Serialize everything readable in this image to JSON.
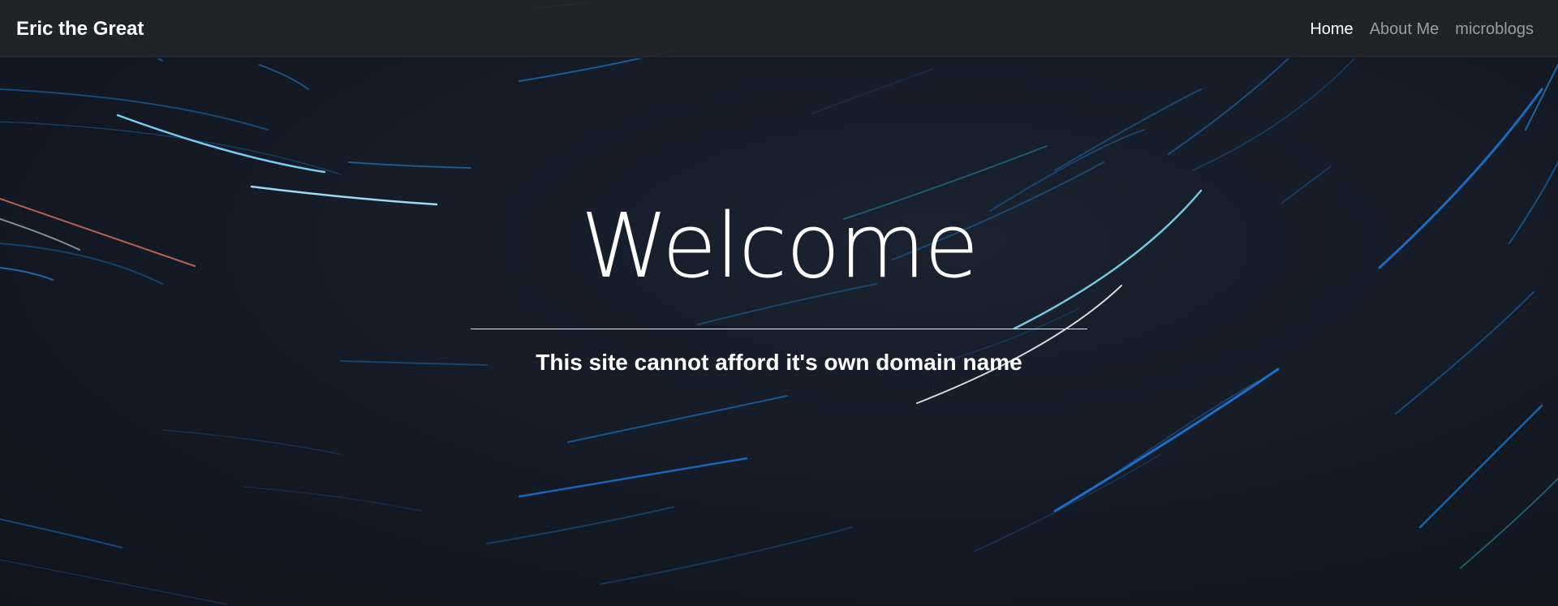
{
  "navbar": {
    "brand": "Eric the Great",
    "links": [
      {
        "label": "Home",
        "active": true
      },
      {
        "label": "About Me",
        "active": false
      },
      {
        "label": "microblogs",
        "active": false
      }
    ]
  },
  "hero": {
    "title": "Welcome",
    "subtitle": "This site cannot afford it's own domain name"
  },
  "colors": {
    "background": "#141a24",
    "navbar": "#212529",
    "text": "#ffffff",
    "nav_inactive": "rgba(255,255,255,0.55)",
    "streak_blue": "#1e7be0",
    "streak_cyan": "#6ad0f5",
    "streak_red": "#e0705a"
  }
}
